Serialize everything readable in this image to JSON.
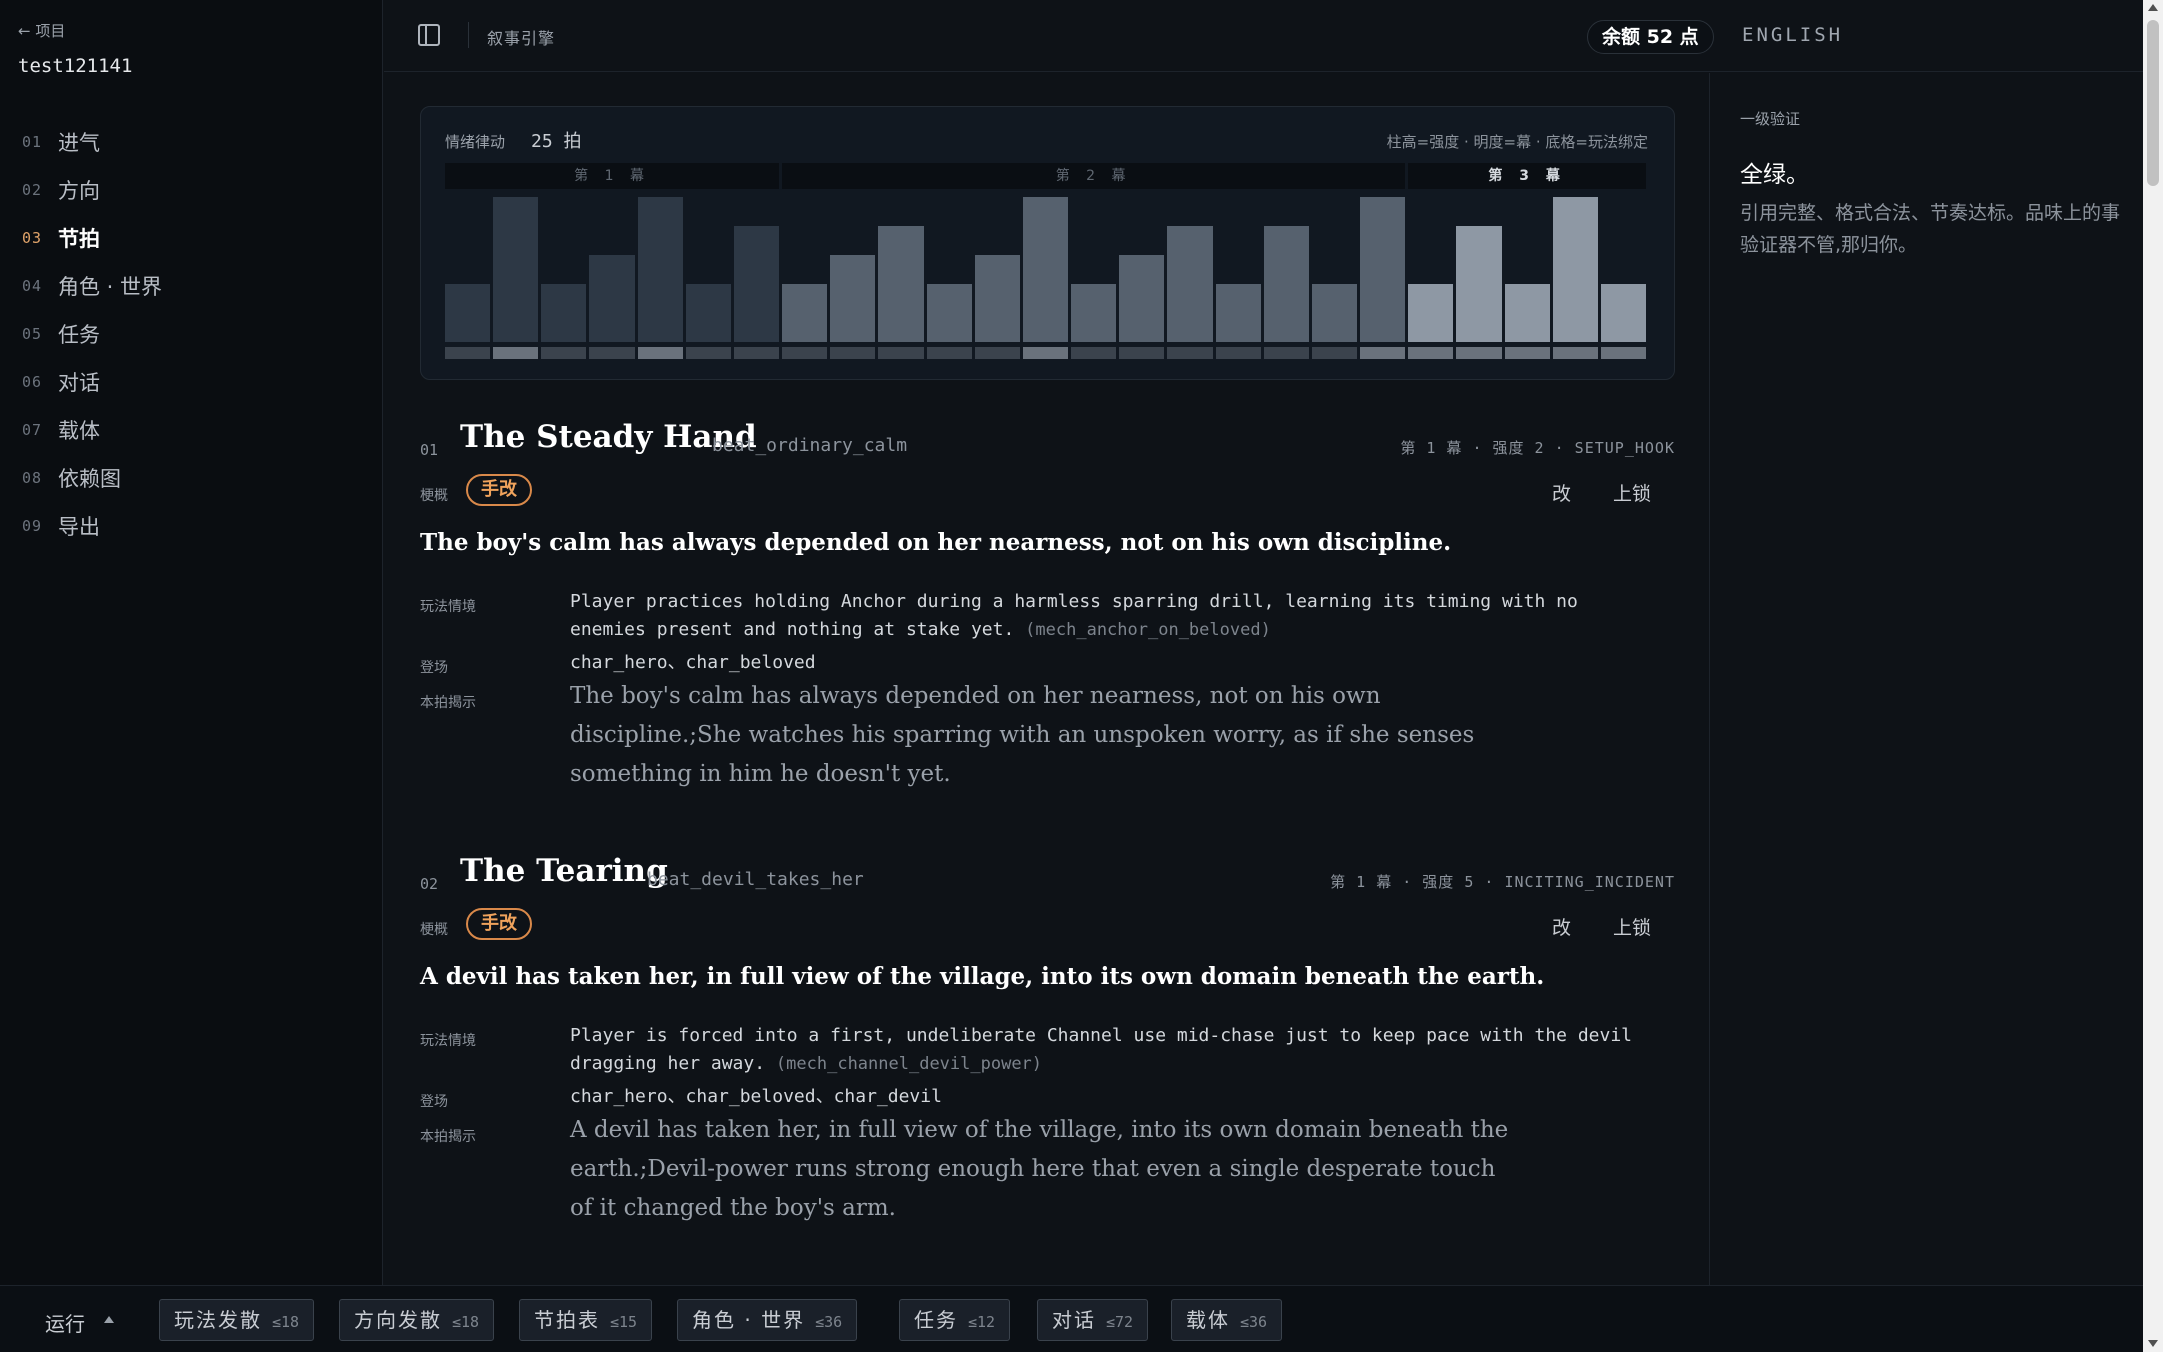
{
  "sidebar": {
    "back_label": "← 项目",
    "project_name": "test121141",
    "items": [
      {
        "num": "01",
        "label": "进气",
        "active": false
      },
      {
        "num": "02",
        "label": "方向",
        "active": false
      },
      {
        "num": "03",
        "label": "节拍",
        "active": true
      },
      {
        "num": "04",
        "label": "角色 · 世界",
        "active": false
      },
      {
        "num": "05",
        "label": "任务",
        "active": false
      },
      {
        "num": "06",
        "label": "对话",
        "active": false
      },
      {
        "num": "07",
        "label": "载体",
        "active": false
      },
      {
        "num": "08",
        "label": "依赖图",
        "active": false
      },
      {
        "num": "09",
        "label": "导出",
        "active": false
      }
    ]
  },
  "header": {
    "title": "叙事引擎",
    "balance": "余额 52 点",
    "language": "ENGLISH"
  },
  "rhythm": {
    "label": "情绪律动",
    "count": "25 拍",
    "legend": "柱高=强度 · 明度=幕 · 底格=玩法绑定",
    "acts": [
      {
        "label": "第 1 幕",
        "beats": 7,
        "active": false
      },
      {
        "label": "第 2 幕",
        "beats": 13,
        "active": false
      },
      {
        "label": "第 3 幕",
        "beats": 5,
        "active": true
      }
    ],
    "intensities": [
      2,
      5,
      2,
      3,
      5,
      2,
      4,
      2,
      3,
      4,
      2,
      3,
      5,
      2,
      3,
      4,
      2,
      4,
      2,
      5,
      2,
      4,
      2,
      5,
      2
    ],
    "intensity_max": 5,
    "colors": {
      "act1": "#2d3845",
      "act2": "#56616e",
      "act3": "#8e98a4",
      "binding": "#3b434d",
      "binding_bright": "#6a727c"
    }
  },
  "beats": [
    {
      "num": "01",
      "title": "The Steady Hand",
      "id": "beat_ordinary_calm",
      "meta": "第 1 幕 · 强度 2 · SETUP_HOOK",
      "synopsis_label": "梗概",
      "badge": "手改",
      "edit_label": "改",
      "lock_label": "上锁",
      "synopsis": "The boy's calm has always depended on her nearness, not on his own discipline.",
      "gameplay_label": "玩法情境",
      "gameplay": "Player practices holding Anchor during a harmless sparring drill, learning its timing with no enemies present and nothing at stake yet.",
      "gameplay_ref": "(mech_anchor_on_beloved)",
      "cast_label": "登场",
      "cast": "char_hero、char_beloved",
      "reveal_label": "本拍揭示",
      "reveal": "The boy's calm has always depended on her nearness, not on his own discipline.;She watches his sparring with an unspoken worry, as if she senses something in him he doesn't yet."
    },
    {
      "num": "02",
      "title": "The Tearing",
      "id": "beat_devil_takes_her",
      "meta": "第 1 幕 · 强度 5 · INCITING_INCIDENT",
      "synopsis_label": "梗概",
      "badge": "手改",
      "edit_label": "改",
      "lock_label": "上锁",
      "synopsis": "A devil has taken her, in full view of the village, into its own domain beneath the earth.",
      "gameplay_label": "玩法情境",
      "gameplay": "Player is forced into a first, undeliberate Channel use mid-chase just to keep pace with the devil dragging her away.",
      "gameplay_ref": "(mech_channel_devil_power)",
      "cast_label": "登场",
      "cast": "char_hero、char_beloved、char_devil",
      "reveal_label": "本拍揭示",
      "reveal": "A devil has taken her, in full view of the village, into its own domain beneath the earth.;Devil-power runs strong enough here that even a single desperate touch of it changed the boy's arm."
    }
  ],
  "verification": {
    "label": "一级验证",
    "status": "全绿。",
    "description": "引用完整、格式合法、节奏达标。品味上的事验证器不管,那归你。"
  },
  "bottom": {
    "run_label": "运行",
    "tasks": [
      {
        "name": "玩法发散",
        "limit": "≤18"
      },
      {
        "name": "方向发散",
        "limit": "≤18"
      },
      {
        "name": "节拍表",
        "limit": "≤15"
      },
      {
        "name": "角色 · 世界",
        "limit": "≤36"
      },
      {
        "name": "任务",
        "limit": "≤12"
      },
      {
        "name": "对话",
        "limit": "≤72"
      },
      {
        "name": "载体",
        "limit": "≤36"
      }
    ]
  }
}
